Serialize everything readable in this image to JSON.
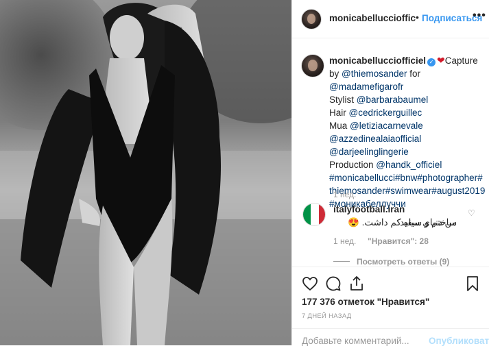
{
  "header": {
    "username": "monicabelluccioffic",
    "dot": "•",
    "follow_label": "Подписаться",
    "more_icon": "more-icon"
  },
  "photo": {
    "description_icon": "post-photo"
  },
  "caption": {
    "username": "monicabellucciofficiel",
    "heart": "❤",
    "word_capture": "Capture",
    "by": "by ",
    "photographer": "@thiemosander",
    "for": " for",
    "magazine": "@madamefigarofr",
    "stylist_label": "Stylist ",
    "stylist": "@barbarabaumel",
    "hair_label": "Hair ",
    "hair": "@cedrickerguillec",
    "mua_label": "Mua ",
    "mua": "@letiziacarnevale",
    "brand1": "@azzedinealaiaofficial",
    "brand2": "@darjeelinglingerie",
    "production_label": "Production ",
    "production": "@handk_officiel",
    "tags_line1": "#monicabellucci#bnw#photographer#",
    "tags_line2": "thiemosander#swimwear#august2019",
    "tags_line3": "#моникабеллуччи",
    "time": "1 нед."
  },
  "comment": {
    "username": "italyfootball.iran",
    "text_line1": "من دنیای سفید",
    "text_line2": "ساختم و سیاه کم داشت.",
    "emoji": "😍",
    "time": "1 нед.",
    "likes": "\"Нравится\": 28",
    "view_replies": "Посмотреть ответы (9)"
  },
  "actions": {
    "likes_count": "177 376 отметок \"Нравится\"",
    "date": "7 ДНЕЙ НАЗАД",
    "comment_placeholder": "Добавьте комментарий...",
    "publish_label": "Опубликовать"
  },
  "colors": {
    "link": "#003569",
    "accent": "#3897f0",
    "muted": "#999999",
    "publish_disabled": "#b2dffc"
  }
}
